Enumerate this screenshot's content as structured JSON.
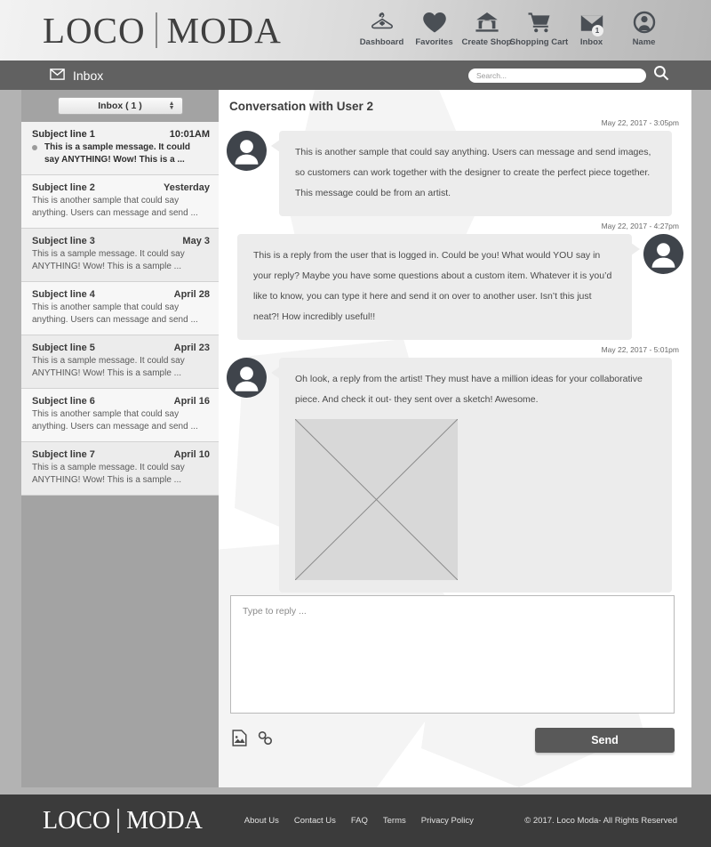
{
  "brand": {
    "word1": "LOCO",
    "word2": "MODA"
  },
  "nav": [
    {
      "label": "Dashboard",
      "icon": "hanger-icon"
    },
    {
      "label": "Favorites",
      "icon": "heart-icon"
    },
    {
      "label": "Create Shop",
      "icon": "shop-icon"
    },
    {
      "label": "Shopping Cart",
      "icon": "cart-icon"
    },
    {
      "label": "Inbox",
      "icon": "envelope-icon",
      "badge": "1"
    },
    {
      "label": "Name",
      "icon": "user-icon"
    }
  ],
  "subheader": {
    "title": "Inbox",
    "icon": "envelope-icon"
  },
  "search": {
    "placeholder": "Search...",
    "value": "",
    "icon": "search-icon"
  },
  "sidebar": {
    "folder_select": {
      "label": "Inbox ( 1 )",
      "icon": "stepper-icon"
    },
    "messages": [
      {
        "subject": "Subject line 1",
        "date": "10:01AM",
        "preview": "This is a sample message.  It could say ANYTHING!  Wow!  This is a  ...",
        "unread": true
      },
      {
        "subject": "Subject line 2",
        "date": "Yesterday",
        "preview": "This is another sample that could say anything.  Users can message and send  ...",
        "unread": false
      },
      {
        "subject": "Subject line 3",
        "date": "May 3",
        "preview": "This is a sample message.  It could say ANYTHING!  Wow!  This is a sample  ...",
        "unread": false
      },
      {
        "subject": "Subject line 4",
        "date": "April 28",
        "preview": "This is another sample that could say anything.  Users can message and send  ...",
        "unread": false
      },
      {
        "subject": "Subject line 5",
        "date": "April 23",
        "preview": "This is a sample message.  It could say ANYTHING!  Wow!  This is a sample  ...",
        "unread": false
      },
      {
        "subject": "Subject line 6",
        "date": "April 16",
        "preview": "This is another sample that could say anything.  Users can message and send  ...",
        "unread": false
      },
      {
        "subject": "Subject line 7",
        "date": "April 10",
        "preview": "This is a sample message.  It could say ANYTHING!  Wow!  This is a sample  ...",
        "unread": false
      }
    ]
  },
  "conversation": {
    "title": "Conversation with User 2",
    "messages": [
      {
        "time": "May 22, 2017 - 3:05pm",
        "side": "them",
        "text": "This is another sample that could say anything.  Users can message and send images, so customers can work together with the designer to create the perfect piece together.  This message could be from an artist.",
        "has_image": false
      },
      {
        "time": "May 22, 2017 - 4:27pm",
        "side": "me",
        "text": "This is a reply from the user that is logged in.  Could be you!  What would YOU say in your reply?  Maybe you have some questions about a custom item.  Whatever it is you’d like to know, you can type it here and send it on over to another user.  Isn’t this just neat?!  How incredibly useful!!",
        "has_image": false
      },
      {
        "time": "May 22, 2017 - 5:01pm",
        "side": "them",
        "text": "Oh look, a reply from the artist!  They must have a million ideas for your collaborative piece.  And check it out- they sent over a sketch!  Awesome.",
        "has_image": true
      }
    ]
  },
  "composer": {
    "placeholder": "Type to reply ...",
    "value": "",
    "send_label": "Send",
    "attach_image_icon": "image-attach-icon",
    "attach_link_icon": "link-icon"
  },
  "footer": {
    "links": [
      "About Us",
      "Contact Us",
      "FAQ",
      "Terms",
      "Privacy Policy"
    ],
    "copyright": "© 2017.  Loco Moda- All Rights Reserved"
  },
  "colors": {
    "header_dark": "#616161",
    "footer_dark": "#3b3b3b",
    "page_bg": "#b3b3b3",
    "avatar": "#3f444b",
    "bubble": "#ececec",
    "send_button": "#595959"
  }
}
